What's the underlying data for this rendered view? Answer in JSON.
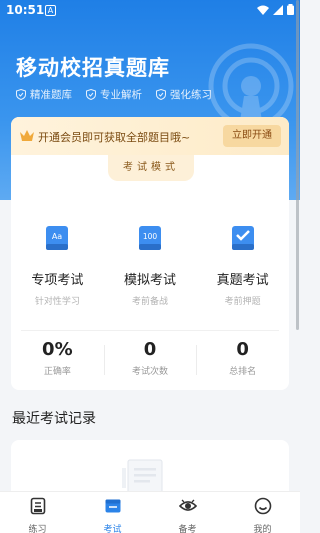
{
  "status_bar": {
    "time": "10:51",
    "notification_icon": "A"
  },
  "header": {
    "title": "移动校招真题库",
    "features": [
      {
        "label": "精准题库",
        "icon": "shield-check-icon"
      },
      {
        "label": "专业解析",
        "icon": "shield-check-icon"
      },
      {
        "label": "强化练习",
        "icon": "shield-check-icon"
      }
    ]
  },
  "promo": {
    "text": "开通会员即可获取全部题目哦~",
    "button": "立即开通"
  },
  "exam_modes": {
    "title": "考试模式",
    "items": [
      {
        "name": "专项考试",
        "desc": "针对性学习",
        "icon": "Aa"
      },
      {
        "name": "模拟考试",
        "desc": "考前备战",
        "icon": "100"
      },
      {
        "name": "真题考试",
        "desc": "考前押题",
        "icon": "check"
      }
    ]
  },
  "stats": [
    {
      "value": "0%",
      "label": "正确率"
    },
    {
      "value": "0",
      "label": "考试次数"
    },
    {
      "value": "0",
      "label": "总排名"
    }
  ],
  "recent": {
    "title": "最近考试记录"
  },
  "tabbar": {
    "items": [
      {
        "label": "练习",
        "icon": "notebook-icon",
        "active": false
      },
      {
        "label": "考试",
        "icon": "exam-folder-icon",
        "active": true
      },
      {
        "label": "备考",
        "icon": "eye-icon",
        "active": false
      },
      {
        "label": "我的",
        "icon": "smile-face-icon",
        "active": false
      }
    ]
  },
  "colors": {
    "primary": "#2b83e8",
    "promo_text": "#7a4a10",
    "promo_button": "#f7d8a0"
  }
}
